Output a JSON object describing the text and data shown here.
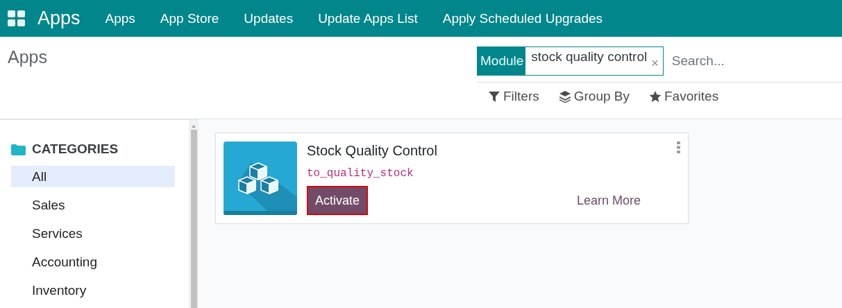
{
  "navbar": {
    "brand": "Apps",
    "menu": [
      "Apps",
      "App Store",
      "Updates",
      "Update Apps List",
      "Apply Scheduled Upgrades"
    ]
  },
  "breadcrumb": "Apps",
  "search": {
    "facet_label": "Module",
    "facet_value": "stock quality control",
    "facet_remove": "×",
    "placeholder": "Search..."
  },
  "search_options": [
    {
      "kind": "filter",
      "label": "Filters"
    },
    {
      "kind": "group",
      "label": "Group By"
    },
    {
      "kind": "favorite",
      "label": "Favorites"
    }
  ],
  "sidebar": {
    "heading": "CATEGORIES",
    "items": [
      {
        "label": "All",
        "selected": true
      },
      {
        "label": "Sales",
        "selected": false
      },
      {
        "label": "Services",
        "selected": false
      },
      {
        "label": "Accounting",
        "selected": false
      },
      {
        "label": "Inventory",
        "selected": false
      }
    ]
  },
  "apps": [
    {
      "name": "Stock Quality Control",
      "technical_name": "to_quality_stock",
      "activate": {
        "label": "Activate",
        "highlighted": true
      },
      "learn_more": "Learn More"
    }
  ]
}
